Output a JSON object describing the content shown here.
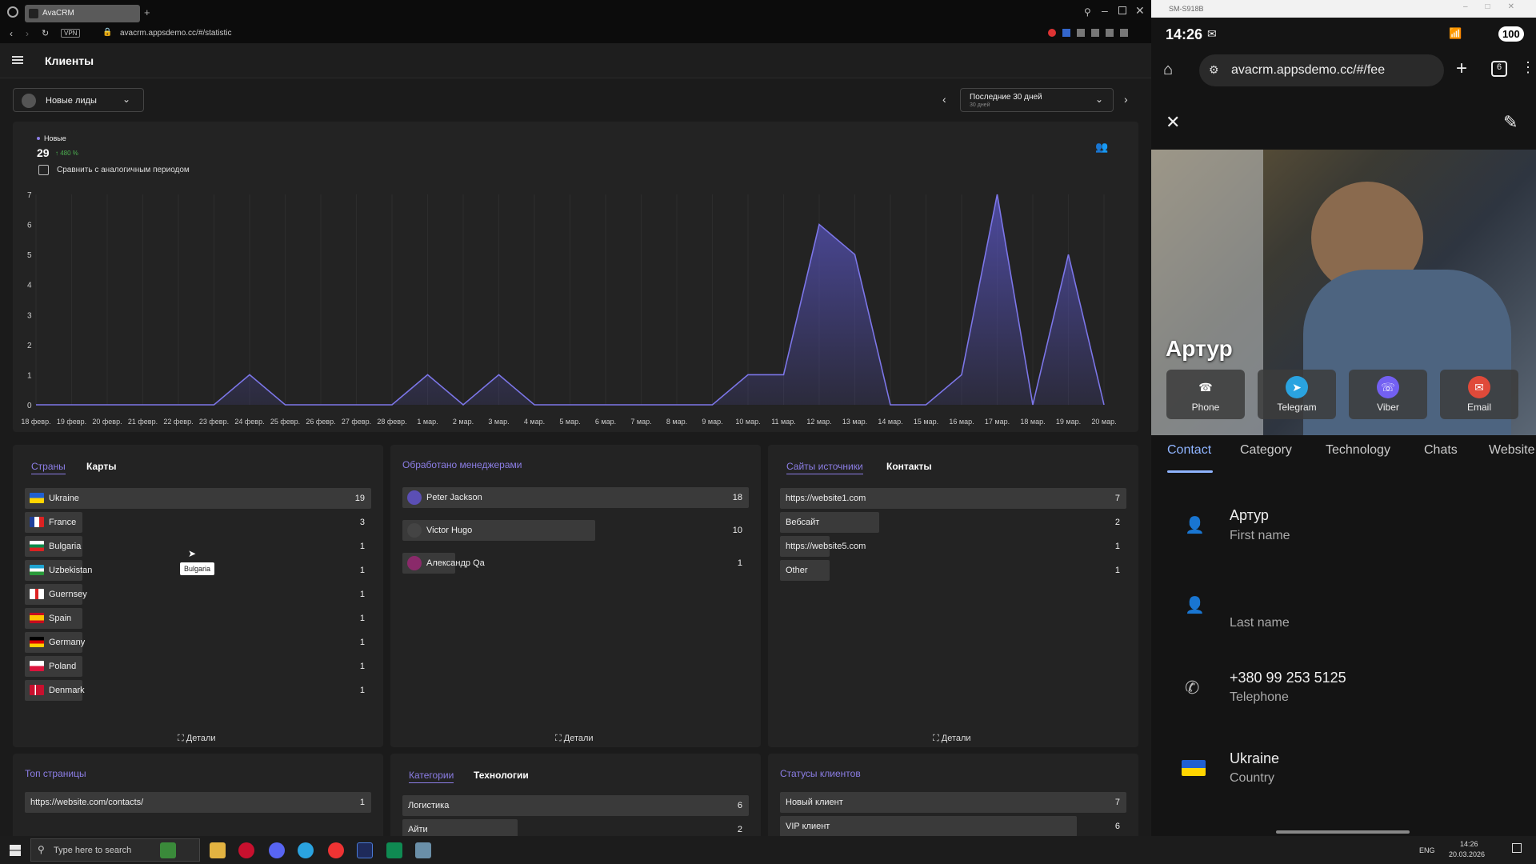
{
  "browser": {
    "tab_title": "AvaCRM",
    "url": "avacrm.appsdemo.cc/#/statistic",
    "vpn_label": "VPN"
  },
  "app": {
    "title": "Клиенты",
    "filter_label": "Новые лиды",
    "period_label": "Последние 30 дней",
    "period_sub": "30 дней"
  },
  "stats": {
    "legend_label": "Новые",
    "total": "29",
    "change": "↑ 480 %",
    "compare_label": "Сравнить с аналогичным периодом"
  },
  "chart_data": {
    "type": "area",
    "x": [
      "18 февр.",
      "19 февр.",
      "20 февр.",
      "21 февр.",
      "22 февр.",
      "23 февр.",
      "24 февр.",
      "25 февр.",
      "26 февр.",
      "27 февр.",
      "28 февр.",
      "1 мар.",
      "2 мар.",
      "3 мар.",
      "4 мар.",
      "5 мар.",
      "6 мар.",
      "7 мар.",
      "8 мар.",
      "9 мар.",
      "10 мар.",
      "11 мар.",
      "12 мар.",
      "13 мар.",
      "14 мар.",
      "15 мар.",
      "16 мар.",
      "17 мар.",
      "18 мар.",
      "19 мар.",
      "20 мар."
    ],
    "series": [
      {
        "values": [
          0,
          0,
          0,
          0,
          0,
          0,
          1,
          0,
          0,
          0,
          0,
          1,
          0,
          1,
          0,
          0,
          0,
          0,
          0,
          0,
          1,
          1,
          6,
          5,
          0,
          0,
          1,
          7,
          0,
          5,
          0
        ]
      }
    ],
    "yticks": [
      "0",
      "1",
      "2",
      "3",
      "4",
      "5",
      "6",
      "7"
    ],
    "ylim": [
      0,
      7
    ],
    "color": "#5b57c8"
  },
  "countries": {
    "tab_active": "Страны",
    "tab_other": "Карты",
    "rows": [
      {
        "label": "Ukraine",
        "value": "19",
        "frac": 1.0
      },
      {
        "label": "France",
        "value": "3",
        "frac": 0.158
      },
      {
        "label": "Bulgaria",
        "value": "1",
        "frac": 0.053
      },
      {
        "label": "Uzbekistan",
        "value": "1",
        "frac": 0.053
      },
      {
        "label": "Guernsey",
        "value": "1",
        "frac": 0.053
      },
      {
        "label": "Spain",
        "value": "1",
        "frac": 0.053
      },
      {
        "label": "Germany",
        "value": "1",
        "frac": 0.053
      },
      {
        "label": "Poland",
        "value": "1",
        "frac": 0.053
      },
      {
        "label": "Denmark",
        "value": "1",
        "frac": 0.053
      }
    ],
    "tooltip": "Bulgaria",
    "details": "Детали"
  },
  "managers": {
    "title": "Обработано менеджерами",
    "rows": [
      {
        "label": "Peter Jackson",
        "value": "18",
        "frac": 1.0
      },
      {
        "label": "Victor Hugo",
        "value": "10",
        "frac": 0.556
      },
      {
        "label": "Александр Qa",
        "value": "1",
        "frac": 0.056
      }
    ],
    "details": "Детали"
  },
  "sources": {
    "tab_active": "Сайты источники",
    "tab_other": "Контакты",
    "rows": [
      {
        "label": "https://website1.com",
        "value": "7",
        "frac": 1.0
      },
      {
        "label": "Вебсайт",
        "value": "2",
        "frac": 0.286
      },
      {
        "label": "https://website5.com",
        "value": "1",
        "frac": 0.143
      },
      {
        "label": "Other",
        "value": "1",
        "frac": 0.143
      }
    ],
    "details": "Детали"
  },
  "top_pages": {
    "title": "Топ страницы",
    "rows": [
      {
        "label": "https://website.com/contacts/",
        "value": "1",
        "frac": 1.0
      }
    ]
  },
  "categories": {
    "tab_active": "Категории",
    "tab_other": "Технологии",
    "rows": [
      {
        "label": "Логистика",
        "value": "6",
        "frac": 1.0
      },
      {
        "label": "Айти",
        "value": "2",
        "frac": 0.333
      }
    ]
  },
  "statuses": {
    "title": "Статусы клиентов",
    "rows": [
      {
        "label": "Новый клиент",
        "value": "7",
        "frac": 1.0
      },
      {
        "label": "VIP клиент",
        "value": "6",
        "frac": 0.857
      }
    ]
  },
  "phone": {
    "window_title": "SM-S918B",
    "time": "14:26",
    "battery": "100",
    "url": "avacrm.appsdemo.cc/#/fee",
    "tabs_count": "6",
    "contact_name": "Артур",
    "actions": [
      "Phone",
      "Telegram",
      "Viber",
      "Email"
    ],
    "tabs": [
      "Contact",
      "Category",
      "Technology",
      "Chats",
      "Website"
    ],
    "fields": [
      {
        "value": "Артур",
        "label": "First name",
        "icon": "person-icon"
      },
      {
        "value": "",
        "label": "Last name",
        "icon": "person-icon"
      },
      {
        "value": "+380 99 253 5125",
        "label": "Telephone",
        "icon": "phone-icon"
      },
      {
        "value": "Ukraine",
        "label": "Country",
        "icon": "flag-icon"
      }
    ]
  },
  "taskbar": {
    "search_placeholder": "Type here to search",
    "lang": "ENG",
    "time": "14:26",
    "date": "20.03.2026"
  }
}
